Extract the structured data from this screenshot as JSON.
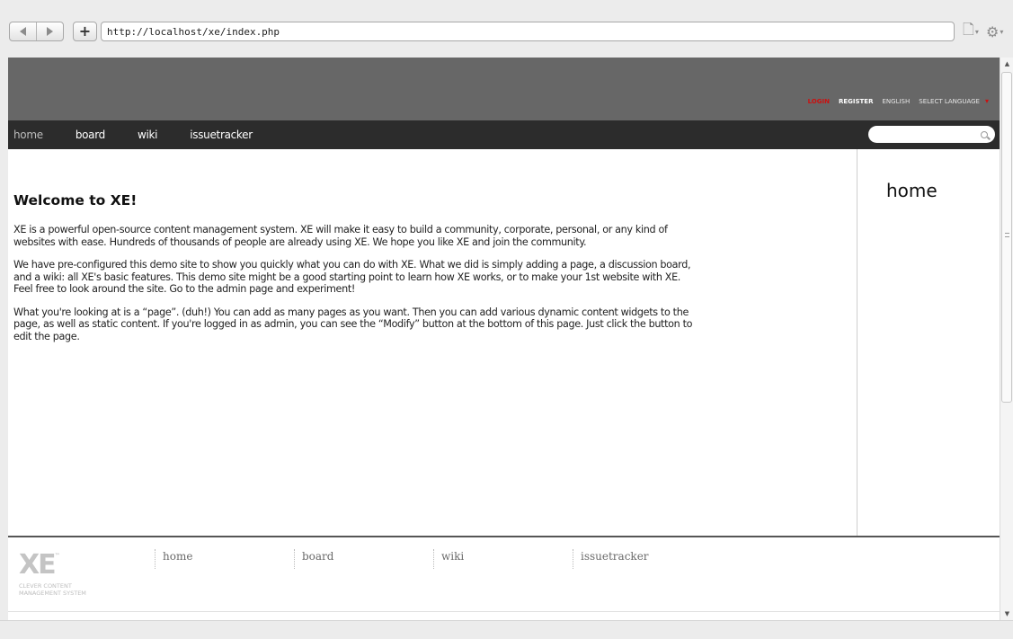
{
  "browser": {
    "url": "http://localhost/xe/index.php",
    "icons": [
      "back-icon",
      "forward-icon",
      "add-bookmark-icon",
      "page-icon",
      "gear-icon"
    ]
  },
  "header": {
    "login": "LOGIN",
    "register": "REGISTER",
    "language": "ENGLISH",
    "select_language": "SELECT LANGUAGE"
  },
  "menu": {
    "items": [
      "home",
      "board",
      "wiki",
      "issuetracker"
    ],
    "active": "home"
  },
  "search": {
    "placeholder": ""
  },
  "article": {
    "title": "Welcome to XE!",
    "paragraphs": [
      "XE is a powerful open-source content management system. XE will make it easy to build a community, corporate, personal, or any kind of websites with ease. Hundreds of thousands of people are already using XE. We hope you like XE and join the community.",
      "We have pre-configured this demo site to show you quickly what you can do with XE. What we did is simply adding a page, a discussion board, and a wiki: all XE's basic features. This demo site might be a good starting point to learn how XE works, or to make your 1st website with XE. Feel free to look around the site. Go to the admin page and experiment!",
      "What you're looking at is a “page”. (duh!) You can add as many pages as you want. Then you can add various dynamic content widgets to the page, as well as static content. If you're logged in as admin, you can see the “Modify” button at the bottom of this page. Just click the button to edit the page."
    ]
  },
  "sidebar": {
    "title": "home"
  },
  "footer": {
    "logo": "XE",
    "logo_tm": "™",
    "tagline_1": "CLEVER CONTENT",
    "tagline_2": "MANAGEMENT SYSTEM",
    "nav": [
      "home",
      "board",
      "wiki",
      "issuetracker"
    ]
  },
  "colors": {
    "header_bg": "#676767",
    "nav_bg": "#2c2c2c",
    "login_red": "#cc1010"
  }
}
